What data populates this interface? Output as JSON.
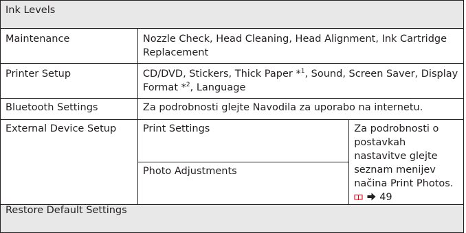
{
  "rows": {
    "ink_levels": "Ink Levels",
    "maintenance": {
      "label": "Maintenance",
      "value": "Nozzle Check, Head Cleaning, Head Alignment, Ink Cartridge Replacement"
    },
    "printer_setup": {
      "label": "Printer Setup",
      "value_part1": "CD/DVD, Stickers, Thick Paper *",
      "sup1": "1",
      "value_part2": ", Sound, Screen Saver, Display Format *",
      "sup2": "2",
      "value_part3": ", Language"
    },
    "bluetooth": {
      "label": "Bluetooth Settings",
      "value": "Za podrobnosti glejte Navodila za uporabo na internetu."
    },
    "external": {
      "label": "External Device Setup",
      "sub1": "Print Settings",
      "sub2": "Photo Adjustments",
      "note": "Za podrobnosti o postavkah nastavitve glejte seznam menijev načina Print Photos.",
      "page_ref": "49"
    },
    "restore": "Restore Default Settings"
  },
  "icons": {
    "book": "book-icon",
    "arrow": "arrow-right-icon",
    "book_color": "#e60012",
    "arrow_color": "#231f20"
  }
}
